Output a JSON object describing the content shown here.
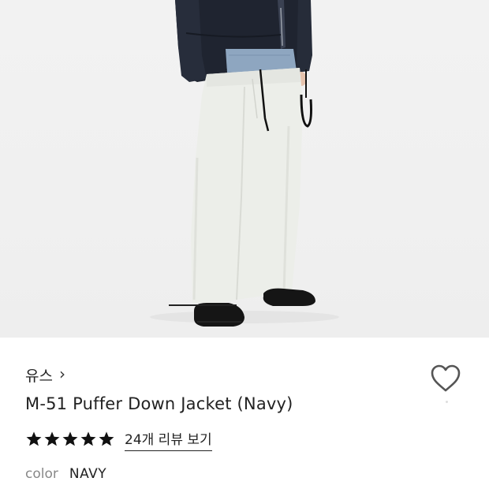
{
  "product": {
    "brand": "유스",
    "brand_chevron": "›",
    "name": "M-51 Puffer Down Jacket (Navy)",
    "rating_stars": 5,
    "review_link": "24개 리뷰 보기",
    "color_label": "color",
    "color_value": "NAVY"
  },
  "colors": {
    "star": "#111111",
    "heart_outline": "#555555",
    "jacket": "#1f2430",
    "pants": "#eceee9"
  },
  "icons": {
    "wishlist": "heart-outline-icon",
    "star": "star-icon",
    "brand_nav": "chevron-right-icon"
  }
}
